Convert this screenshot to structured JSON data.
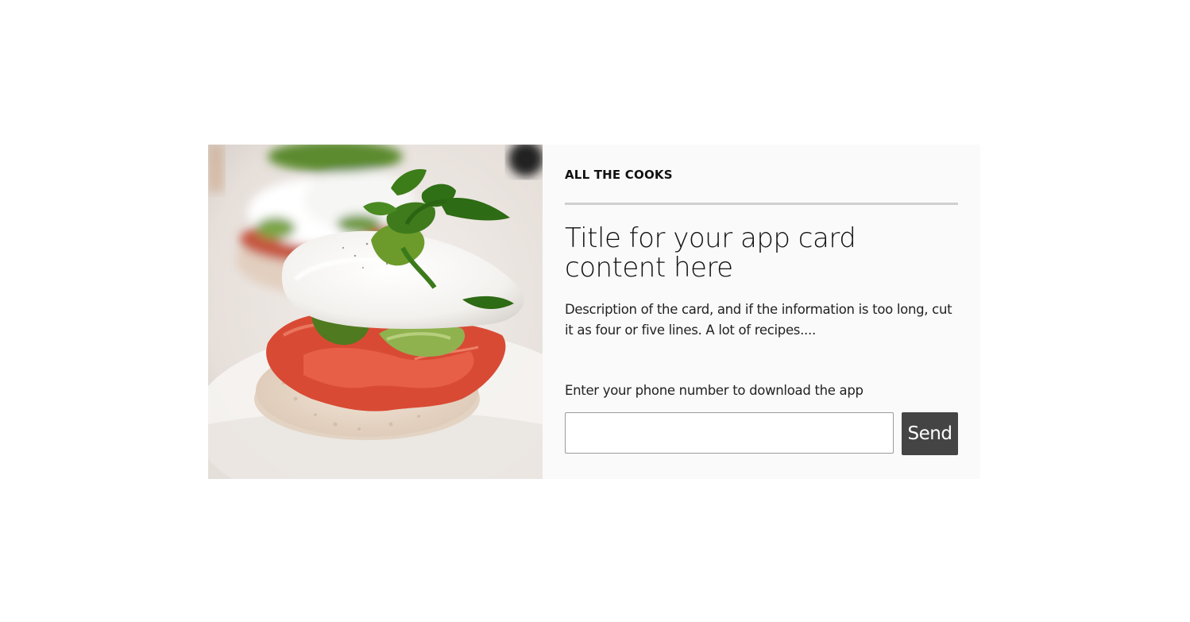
{
  "card": {
    "image": {
      "icon": "food-photo-image"
    },
    "brand": "ALL THE COOKS",
    "title": "Title for your app card content here",
    "description": "Description of the card, and if the information is too long, cut it as four or five lines. A lot of recipes....",
    "phone_form": {
      "label": "Enter your phone number to download the app",
      "input_value": "",
      "send_label": "Send"
    }
  },
  "colors": {
    "page_background": "#ffffff",
    "card_background": "#fafafa",
    "divider": "#cfcfcf",
    "button_background": "#444444",
    "button_text": "#ffffff"
  }
}
